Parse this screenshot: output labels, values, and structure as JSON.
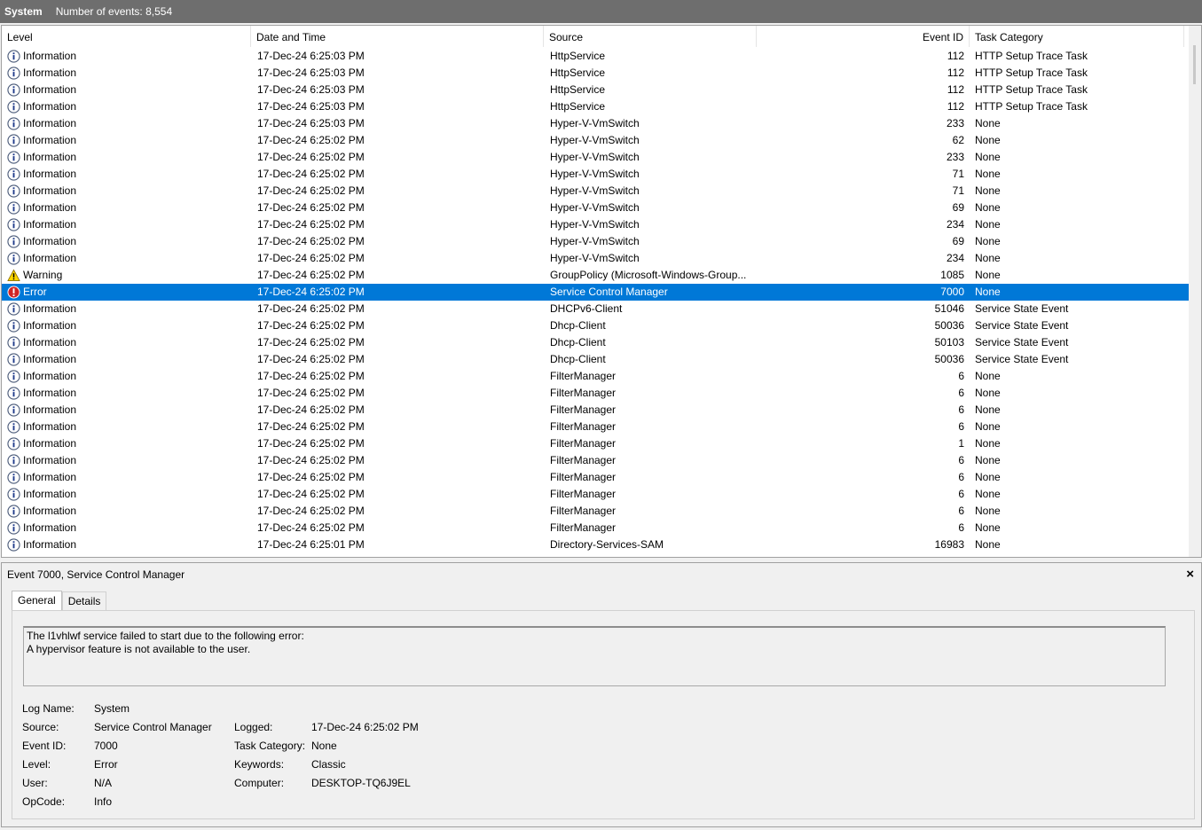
{
  "titlebar": {
    "log_name": "System",
    "event_count": "Number of events: 8,554"
  },
  "columns": {
    "level": "Level",
    "date": "Date and Time",
    "source": "Source",
    "event_id": "Event ID",
    "task_category": "Task Category"
  },
  "events": [
    {
      "level": "Information",
      "icon": "info-icon",
      "date": "17-Dec-24 6:25:03 PM",
      "source": "HttpService",
      "event_id": "112",
      "task_category": "HTTP Setup Trace Task"
    },
    {
      "level": "Information",
      "icon": "info-icon",
      "date": "17-Dec-24 6:25:03 PM",
      "source": "HttpService",
      "event_id": "112",
      "task_category": "HTTP Setup Trace Task"
    },
    {
      "level": "Information",
      "icon": "info-icon",
      "date": "17-Dec-24 6:25:03 PM",
      "source": "HttpService",
      "event_id": "112",
      "task_category": "HTTP Setup Trace Task"
    },
    {
      "level": "Information",
      "icon": "info-icon",
      "date": "17-Dec-24 6:25:03 PM",
      "source": "HttpService",
      "event_id": "112",
      "task_category": "HTTP Setup Trace Task"
    },
    {
      "level": "Information",
      "icon": "info-icon",
      "date": "17-Dec-24 6:25:03 PM",
      "source": "Hyper-V-VmSwitch",
      "event_id": "233",
      "task_category": "None"
    },
    {
      "level": "Information",
      "icon": "info-icon",
      "date": "17-Dec-24 6:25:02 PM",
      "source": "Hyper-V-VmSwitch",
      "event_id": "62",
      "task_category": "None"
    },
    {
      "level": "Information",
      "icon": "info-icon",
      "date": "17-Dec-24 6:25:02 PM",
      "source": "Hyper-V-VmSwitch",
      "event_id": "233",
      "task_category": "None"
    },
    {
      "level": "Information",
      "icon": "info-icon",
      "date": "17-Dec-24 6:25:02 PM",
      "source": "Hyper-V-VmSwitch",
      "event_id": "71",
      "task_category": "None"
    },
    {
      "level": "Information",
      "icon": "info-icon",
      "date": "17-Dec-24 6:25:02 PM",
      "source": "Hyper-V-VmSwitch",
      "event_id": "71",
      "task_category": "None"
    },
    {
      "level": "Information",
      "icon": "info-icon",
      "date": "17-Dec-24 6:25:02 PM",
      "source": "Hyper-V-VmSwitch",
      "event_id": "69",
      "task_category": "None"
    },
    {
      "level": "Information",
      "icon": "info-icon",
      "date": "17-Dec-24 6:25:02 PM",
      "source": "Hyper-V-VmSwitch",
      "event_id": "234",
      "task_category": "None"
    },
    {
      "level": "Information",
      "icon": "info-icon",
      "date": "17-Dec-24 6:25:02 PM",
      "source": "Hyper-V-VmSwitch",
      "event_id": "69",
      "task_category": "None"
    },
    {
      "level": "Information",
      "icon": "info-icon",
      "date": "17-Dec-24 6:25:02 PM",
      "source": "Hyper-V-VmSwitch",
      "event_id": "234",
      "task_category": "None"
    },
    {
      "level": "Warning",
      "icon": "warning-icon",
      "date": "17-Dec-24 6:25:02 PM",
      "source": "GroupPolicy (Microsoft-Windows-Group...",
      "event_id": "1085",
      "task_category": "None"
    },
    {
      "level": "Error",
      "icon": "error-icon",
      "date": "17-Dec-24 6:25:02 PM",
      "source": "Service Control Manager",
      "event_id": "7000",
      "task_category": "None",
      "selected": true
    },
    {
      "level": "Information",
      "icon": "info-icon",
      "date": "17-Dec-24 6:25:02 PM",
      "source": "DHCPv6-Client",
      "event_id": "51046",
      "task_category": "Service State Event"
    },
    {
      "level": "Information",
      "icon": "info-icon",
      "date": "17-Dec-24 6:25:02 PM",
      "source": "Dhcp-Client",
      "event_id": "50036",
      "task_category": "Service State Event"
    },
    {
      "level": "Information",
      "icon": "info-icon",
      "date": "17-Dec-24 6:25:02 PM",
      "source": "Dhcp-Client",
      "event_id": "50103",
      "task_category": "Service State Event"
    },
    {
      "level": "Information",
      "icon": "info-icon",
      "date": "17-Dec-24 6:25:02 PM",
      "source": "Dhcp-Client",
      "event_id": "50036",
      "task_category": "Service State Event"
    },
    {
      "level": "Information",
      "icon": "info-icon",
      "date": "17-Dec-24 6:25:02 PM",
      "source": "FilterManager",
      "event_id": "6",
      "task_category": "None"
    },
    {
      "level": "Information",
      "icon": "info-icon",
      "date": "17-Dec-24 6:25:02 PM",
      "source": "FilterManager",
      "event_id": "6",
      "task_category": "None"
    },
    {
      "level": "Information",
      "icon": "info-icon",
      "date": "17-Dec-24 6:25:02 PM",
      "source": "FilterManager",
      "event_id": "6",
      "task_category": "None"
    },
    {
      "level": "Information",
      "icon": "info-icon",
      "date": "17-Dec-24 6:25:02 PM",
      "source": "FilterManager",
      "event_id": "6",
      "task_category": "None"
    },
    {
      "level": "Information",
      "icon": "info-icon",
      "date": "17-Dec-24 6:25:02 PM",
      "source": "FilterManager",
      "event_id": "1",
      "task_category": "None"
    },
    {
      "level": "Information",
      "icon": "info-icon",
      "date": "17-Dec-24 6:25:02 PM",
      "source": "FilterManager",
      "event_id": "6",
      "task_category": "None"
    },
    {
      "level": "Information",
      "icon": "info-icon",
      "date": "17-Dec-24 6:25:02 PM",
      "source": "FilterManager",
      "event_id": "6",
      "task_category": "None"
    },
    {
      "level": "Information",
      "icon": "info-icon",
      "date": "17-Dec-24 6:25:02 PM",
      "source": "FilterManager",
      "event_id": "6",
      "task_category": "None"
    },
    {
      "level": "Information",
      "icon": "info-icon",
      "date": "17-Dec-24 6:25:02 PM",
      "source": "FilterManager",
      "event_id": "6",
      "task_category": "None"
    },
    {
      "level": "Information",
      "icon": "info-icon",
      "date": "17-Dec-24 6:25:02 PM",
      "source": "FilterManager",
      "event_id": "6",
      "task_category": "None"
    },
    {
      "level": "Information",
      "icon": "info-icon",
      "date": "17-Dec-24 6:25:01 PM",
      "source": "Directory-Services-SAM",
      "event_id": "16983",
      "task_category": "None"
    }
  ],
  "detail": {
    "title": "Event 7000, Service Control Manager",
    "close_icon": "×",
    "tabs": {
      "general": "General",
      "details": "Details"
    },
    "description": {
      "line1": "The l1vhlwf service failed to start due to the following error:",
      "line2": "A hypervisor feature is not available to the user."
    },
    "labels": {
      "log_name": "Log Name:",
      "source": "Source:",
      "event_id": "Event ID:",
      "level": "Level:",
      "user": "User:",
      "opcode": "OpCode:",
      "logged": "Logged:",
      "task_category": "Task Category:",
      "keywords": "Keywords:",
      "computer": "Computer:"
    },
    "values": {
      "log_name": "System",
      "source": "Service Control Manager",
      "event_id": "7000",
      "level": "Error",
      "user": "N/A",
      "opcode": "Info",
      "logged": "17-Dec-24 6:25:02 PM",
      "task_category": "None",
      "keywords": "Classic",
      "computer": "DESKTOP-TQ6J9EL"
    }
  },
  "colors": {
    "selection": "#0078d7",
    "titlebar": "#6e6e6e"
  }
}
